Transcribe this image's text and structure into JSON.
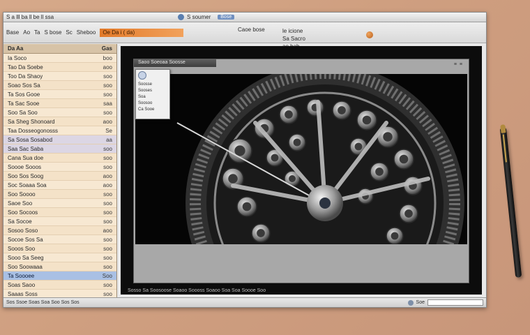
{
  "window": {
    "app_title": "S a lll ba ll be ll ssa",
    "doc_title": "S soumer",
    "doc_badge": "Bose"
  },
  "menubar": {
    "items": [
      "Base",
      "Ao",
      "Ta",
      "S bose",
      "Sc",
      "Sheboo"
    ],
    "orange_label": "Oe Da i ( da)",
    "center_label": "Caoe bose",
    "right_labels": [
      "le icione",
      "Sa Sacro",
      "ao bab"
    ],
    "buttons": [
      "oase",
      "oas",
      "oa"
    ]
  },
  "sidebar": {
    "header_left": "Da Aa",
    "header_right": "Gas",
    "rows": [
      {
        "name": "Ia Soco",
        "value": "boo"
      },
      {
        "name": "Tao Da Soebe",
        "value": "aoo"
      },
      {
        "name": "Too Da Shaoy",
        "value": "soo"
      },
      {
        "name": "Soao Sos Sa",
        "value": "soo"
      },
      {
        "name": "Ta Sos Gooe",
        "value": "soo"
      },
      {
        "name": "Ta Sac Sooe",
        "value": "saa"
      },
      {
        "name": "Soo Sa Soo",
        "value": "soo"
      },
      {
        "name": "Sa Sheg Shonoard",
        "value": "aoo"
      },
      {
        "name": "Taa Dosseogonosss",
        "value": "Se"
      },
      {
        "name": "Sa Sosa Sosabod",
        "value": "aa"
      },
      {
        "name": "Saa Sac Saba",
        "value": "soo"
      },
      {
        "name": "Cana Sua doe",
        "value": "soo"
      },
      {
        "name": "Soooe Sooos",
        "value": "soo"
      },
      {
        "name": "Soo Sos Soog",
        "value": "aoo"
      },
      {
        "name": "Soc Soaaa Soa",
        "value": "aoo"
      },
      {
        "name": "Soo Soooo",
        "value": "soo"
      },
      {
        "name": "Saoe Soo",
        "value": "soo"
      },
      {
        "name": "Soo Socoos",
        "value": "soo"
      },
      {
        "name": "Sa Socoe",
        "value": "soo"
      },
      {
        "name": "Sosoo Soso",
        "value": "aoo"
      },
      {
        "name": "Socoe Sos Sa",
        "value": "soo"
      },
      {
        "name": "Sooos Soo",
        "value": "soo"
      },
      {
        "name": "Sooo Sa Seeg",
        "value": "soo"
      },
      {
        "name": "Soo Soowaaa",
        "value": "soo"
      },
      {
        "name": "Ta Soooee",
        "value": "Soo"
      },
      {
        "name": "Soas Saoo",
        "value": "soo"
      },
      {
        "name": "Saaas Soss",
        "value": "soo"
      },
      {
        "name": "Sa Sooo Soo",
        "value": "soo"
      }
    ]
  },
  "viewer": {
    "panel_title": "Saoo Soeoaa Soosse",
    "grip": "≡ ≡",
    "context_menu": [
      "Soosse",
      "Sooses",
      "Soa",
      "Soosoo",
      "Ca Sooe"
    ],
    "caption": "Sosso Sa Soosoose Soaoo Soooss Soaoo Soa Soa Soooe Soo"
  },
  "statusbar": {
    "left": "Sos Ssoe Soas Soa Soo Sos Sos",
    "right": "Soe"
  }
}
